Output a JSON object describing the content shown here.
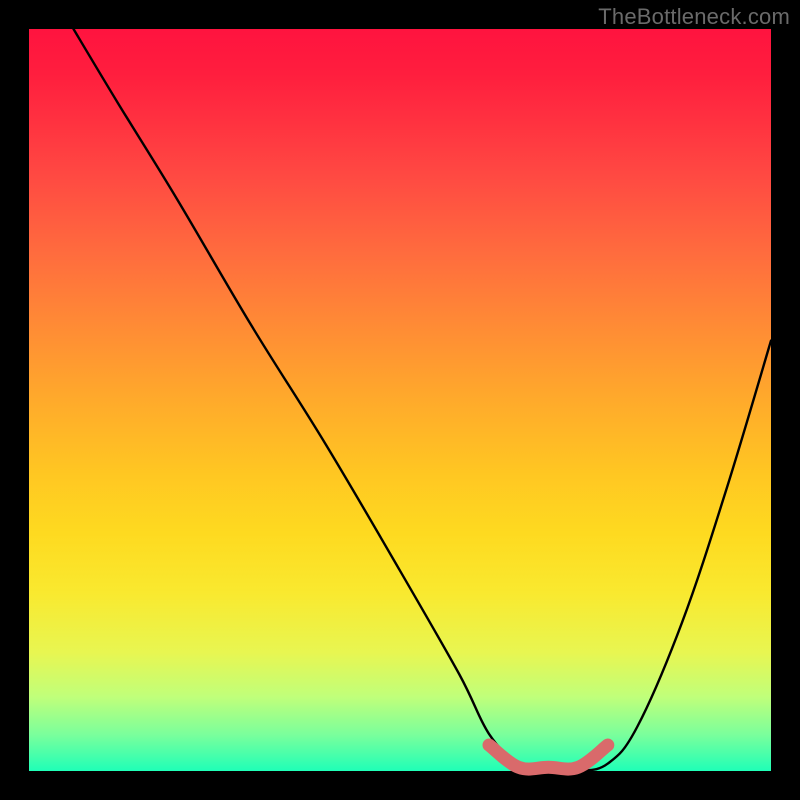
{
  "watermark": "TheBottleneck.com",
  "chart_data": {
    "type": "line",
    "title": "",
    "xlabel": "",
    "ylabel": "",
    "xlim": [
      0,
      100
    ],
    "ylim": [
      0,
      100
    ],
    "grid": false,
    "legend": false,
    "series": [
      {
        "name": "bottleneck-curve",
        "color": "#000000",
        "x": [
          6,
          12,
          20,
          30,
          40,
          50,
          58,
          62,
          66,
          70,
          74,
          78,
          82,
          88,
          94,
          100
        ],
        "y": [
          100,
          90,
          77,
          60,
          44,
          27,
          13,
          5,
          1,
          0,
          0,
          1,
          6,
          20,
          38,
          58
        ]
      },
      {
        "name": "bottleneck-band",
        "color": "#d96a6b",
        "x": [
          62,
          66,
          70,
          74,
          78
        ],
        "y": [
          3.5,
          0.5,
          0.5,
          0.5,
          3.5
        ]
      }
    ],
    "gradient_stops": [
      {
        "pos": 0.0,
        "color": "#ff133f"
      },
      {
        "pos": 0.06,
        "color": "#ff1e3e"
      },
      {
        "pos": 0.12,
        "color": "#ff3040"
      },
      {
        "pos": 0.2,
        "color": "#ff4a42"
      },
      {
        "pos": 0.3,
        "color": "#ff6b3e"
      },
      {
        "pos": 0.4,
        "color": "#ff8b35"
      },
      {
        "pos": 0.5,
        "color": "#ffaa2b"
      },
      {
        "pos": 0.6,
        "color": "#ffc722"
      },
      {
        "pos": 0.68,
        "color": "#feda20"
      },
      {
        "pos": 0.76,
        "color": "#f9e92f"
      },
      {
        "pos": 0.84,
        "color": "#e8f651"
      },
      {
        "pos": 0.9,
        "color": "#c0ff7a"
      },
      {
        "pos": 0.95,
        "color": "#7cff9b"
      },
      {
        "pos": 1.0,
        "color": "#1fffb7"
      }
    ]
  }
}
